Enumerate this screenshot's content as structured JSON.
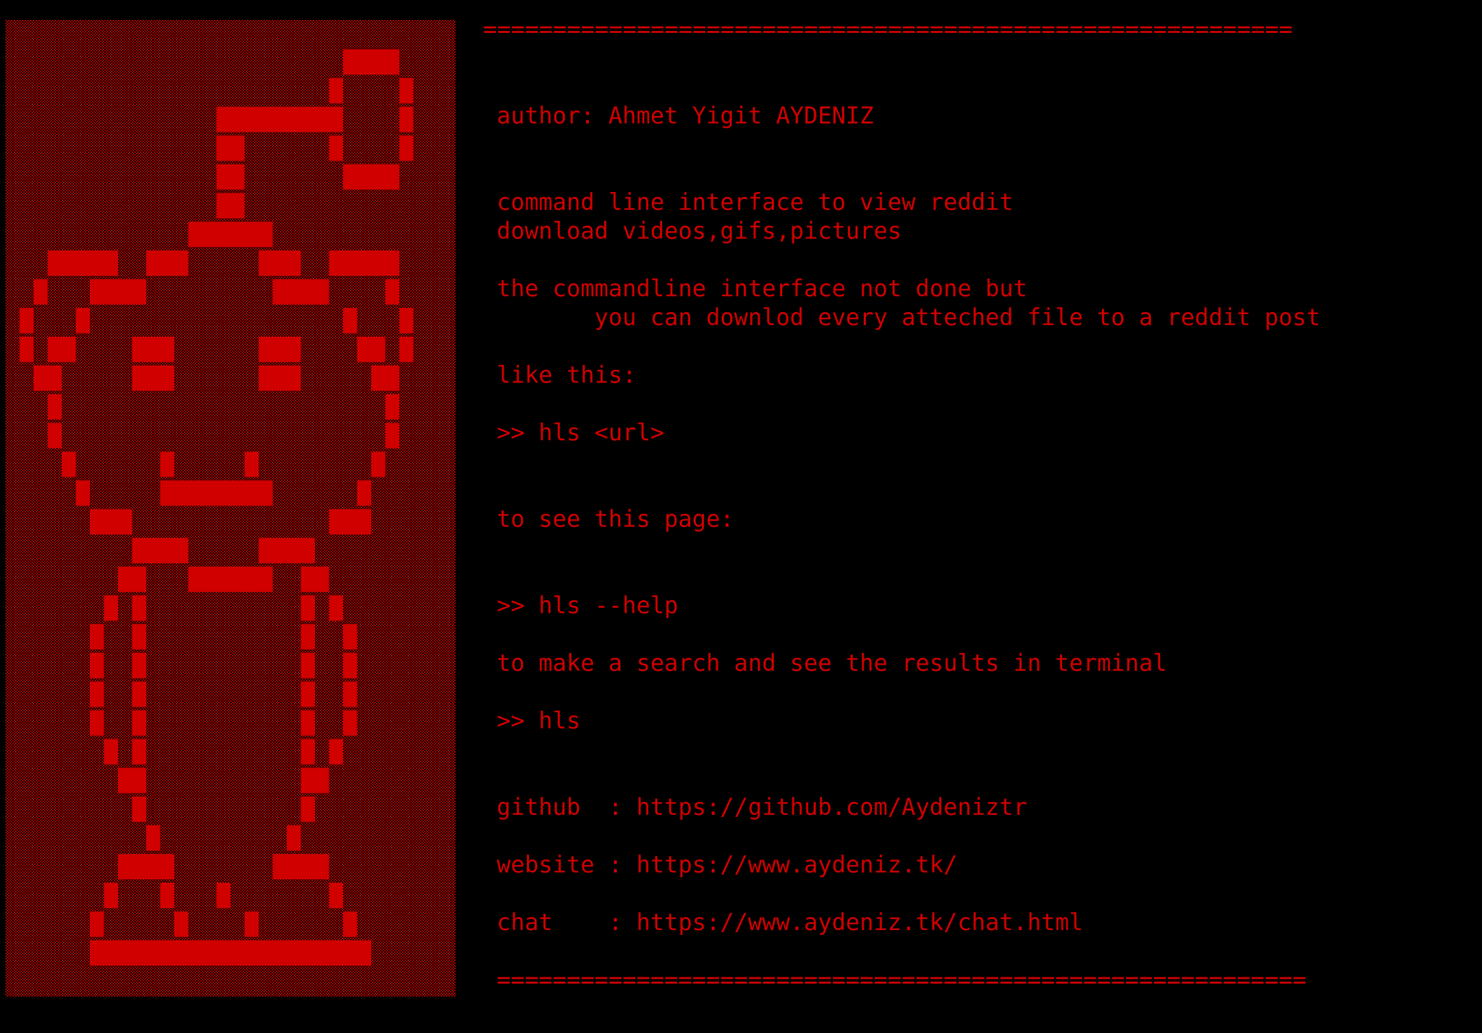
{
  "colors": {
    "background": "#000000",
    "text": "#d00000",
    "art_solid": "#d00000",
    "art_shade": "#b30000"
  },
  "banner_art": {
    "description_icon": "ascii-skull-icon",
    "grid": [
      "...............................",
      "........................####...",
      ".......................#....#..",
      "...............#########....#..",
      "...............##......#....#..",
      "...............##.......####...",
      "...............##..............",
      ".............######............",
      "...#####..###.....###..#####...",
      "..#...####.........####....#...",
      ".#...#..................#...#..",
      ".#.##....###......###....##.#..",
      "..##.....###......###.....##...",
      "...#.......................#...",
      "...#.......................#...",
      "....#......#.....#........#....",
      ".....#.....########......#.....",
      "......###..............###.....",
      ".........####.....####.........",
      "........##...######..##........",
      ".......#.#...........#.#.......",
      "......#..#...........#..#......",
      "......#..#...........#..#......",
      "......#..#...........#..#......",
      "......#..#...........#..#......",
      ".......#.#...........#.#.......",
      "........##...........##........",
      ".........#...........#.........",
      "..........#.........#..........",
      "........####.......####........",
      ".......#...#...#.......#.......",
      "......#.....#....#......#......",
      "......####################.....",
      "..............................."
    ]
  },
  "text": {
    "top_rule": "==========================================================",
    "author": "author: Ahmet Yigit AYDENIZ",
    "desc_1": "command line interface to view reddit",
    "desc_2": "download videos,gifs,pictures",
    "note_1": "the commandline interface not done but",
    "note_2": "       you can downlod every atteched file to a reddit post",
    "like_this": "like this:",
    "cmd_url": ">> hls <url>",
    "see_page": "to see this page:",
    "cmd_help": ">> hls --help",
    "search_info": "to make a search and see the results in terminal",
    "cmd_hls": ">> hls",
    "github": "github  : https://github.com/Aydeniztr",
    "website": "website : https://www.aydeniz.tk/",
    "chat": "chat    : https://www.aydeniz.tk/chat.html",
    "bottom_rule": "=========================================================="
  }
}
